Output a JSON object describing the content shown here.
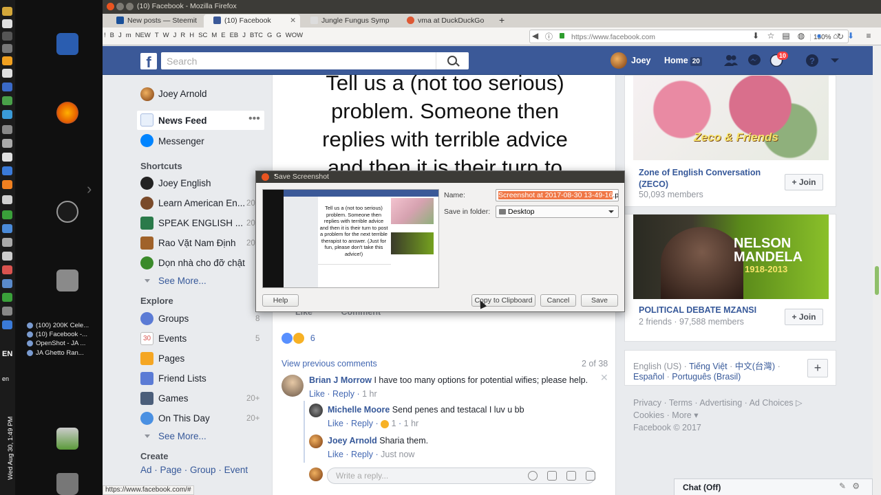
{
  "desktop": {
    "tasks": [
      "(100) 200K Cele...",
      "(10) Facebook -...",
      "OpenShot - JA ...",
      "JA Ghetto Ran..."
    ],
    "lang": "EN",
    "lang_small": "en",
    "clock": "Wed Aug 30,  1:49 PM"
  },
  "window": {
    "title": "(10) Facebook - Mozilla Firefox"
  },
  "tabs": [
    {
      "label": "New posts — Steemit",
      "color": "#1a5099"
    },
    {
      "label": "(10) Facebook",
      "color": "#3b5998"
    },
    {
      "label": "Jungle Fungus Symp",
      "color": "#dddddd"
    },
    {
      "label": "vma at DuckDuckGo",
      "color": "#de5833"
    }
  ],
  "bookmarks": [
    "!",
    "B",
    "J",
    "m",
    "NEW",
    "T",
    "W",
    "J",
    "R",
    "H",
    "SC",
    "M",
    "E",
    "EB",
    "J",
    "BTC",
    "G",
    "G",
    "WOW"
  ],
  "urlbar": {
    "url": "https://www.facebook.com",
    "zoom": "150%"
  },
  "facebook": {
    "search_placeholder": "Search",
    "user_name": "Joey",
    "home_label": "Home",
    "home_count": "20",
    "notif_count": "10",
    "logo": "f"
  },
  "leftnav": {
    "profile": "Joey Arnold",
    "news_feed": "News Feed",
    "messenger": "Messenger",
    "shortcuts_head": "Shortcuts",
    "shortcuts": [
      {
        "label": "Joey English",
        "count": "",
        "color": "#222"
      },
      {
        "label": "Learn American En...",
        "count": "20",
        "color": "#7a4a2a"
      },
      {
        "label": "SPEAK ENGLISH ...",
        "count": "20",
        "color": "#2a7a4a"
      },
      {
        "label": "Rao Vặt Nam Định",
        "count": "20",
        "color": "#a0622a"
      },
      {
        "label": "Dọn nhà cho đỡ chật",
        "count": "",
        "color": "#3a8a2a"
      }
    ],
    "see_more_1": "See More...",
    "explore_head": "Explore",
    "explore": [
      {
        "label": "Groups",
        "count": "8",
        "color": "#5b7bd5"
      },
      {
        "label": "Events",
        "count": "5",
        "color": "#d9534f"
      },
      {
        "label": "Pages",
        "count": "",
        "color": "#f5a623"
      },
      {
        "label": "Friend Lists",
        "count": "",
        "color": "#5b7bd5"
      },
      {
        "label": "Games",
        "count": "20+",
        "color": "#4b5e7a"
      },
      {
        "label": "On This Day",
        "count": "20+",
        "color": "#4a90e2"
      }
    ],
    "events_day": "30",
    "see_more_2": "See More...",
    "create_head": "Create",
    "create_links": [
      "Ad",
      "Page",
      "Group",
      "Event"
    ]
  },
  "post": {
    "image_text": [
      "Tell us a (not too serious)",
      "problem. Someone then",
      "replies with terrible advice",
      "and then it is  their turn to"
    ],
    "like": "Like",
    "comment": "Comment",
    "reaction_count": "6",
    "view_previous": "View previous comments",
    "pagination": "2 of 38",
    "comments": [
      {
        "name": "Brian J Morrow",
        "text": "I have too many options for potential wifies; please help.",
        "like": "Like",
        "reply": "Reply",
        "time": "1 hr"
      },
      {
        "name": "Michelle Moore",
        "text": "Send penes and testacal I luv u bb",
        "like": "Like",
        "reply": "Reply",
        "reactions": "1",
        "time": "1 hr"
      },
      {
        "name": "Joey Arnold",
        "text": "Sharia them.",
        "like": "Like",
        "reply": "Reply",
        "time": "Just now"
      }
    ],
    "reply_placeholder": "Write a reply..."
  },
  "groups": [
    {
      "name": "Zone of English Conversation (ZECO)",
      "meta": "50,093 members",
      "join": "Join",
      "banner": "Zeco & Friends"
    },
    {
      "name": "POLITICAL DEBATE MZANSI",
      "meta": "2 friends · 97,588 members",
      "join": "Join",
      "banner_title": "NELSON MANDELA",
      "banner_years": "1918-2013"
    }
  ],
  "languages": {
    "current": "English (US)",
    "others": [
      "Tiếng Việt",
      "中文(台灣)",
      "Español",
      "Português (Brasil)"
    ]
  },
  "footer": {
    "links": [
      "Privacy",
      "Terms",
      "Advertising",
      "Ad Choices",
      "Cookies",
      "More"
    ],
    "copyright": "Facebook © 2017"
  },
  "chat": {
    "label": "Chat (Off)"
  },
  "statusbar": "https://www.facebook.com/#",
  "dialog": {
    "title": "Save Screenshot",
    "name_label": "Name:",
    "name_value": "Screenshot at 2017-08-30 13-49-16",
    "name_ext": ".png",
    "folder_label": "Save in folder:",
    "folder_value": "Desktop",
    "help": "Help",
    "copy": "Copy to Clipboard",
    "cancel": "Cancel",
    "save": "Save",
    "thumb_text": "Tell us a (not too serious) problem. Someone then replies with terrible advice and then it is their turn to post a problem for the next terrible therapist to answer. (Just for fun, please don't take this advice!)"
  }
}
